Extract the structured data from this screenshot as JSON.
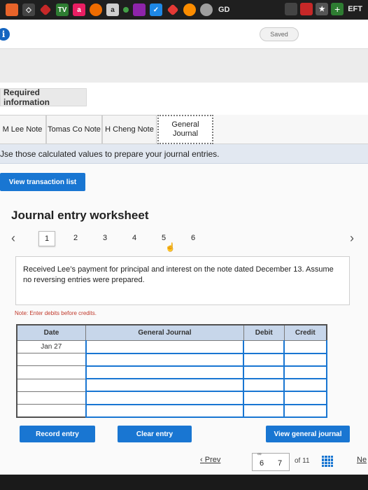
{
  "bookmarks": {
    "items": [
      {
        "icon": "stop-icon",
        "color": "#e8642a",
        "text": ""
      },
      {
        "icon": "cube-icon",
        "color": "#6a6a6a",
        "text": "◇"
      },
      {
        "icon": "diamond-icon",
        "color": "#c62828",
        "text": ""
      },
      {
        "icon": "tv-icon",
        "color": "#2e7d32",
        "text": "TV"
      },
      {
        "icon": "a-icon",
        "color": "#e91e63",
        "text": "a"
      },
      {
        "icon": "circle-icon",
        "color": "#ef6c00",
        "text": ""
      },
      {
        "icon": "amazon-icon",
        "color": "#cfcfcf",
        "text": "a"
      },
      {
        "icon": "dot-icon",
        "color": "#43a047",
        "text": ""
      },
      {
        "icon": "photo-icon",
        "color": "#8e24aa",
        "text": ""
      },
      {
        "icon": "check-icon",
        "color": "#1e88e5",
        "text": ""
      },
      {
        "icon": "gem-icon",
        "color": "#e53935",
        "text": ""
      },
      {
        "icon": "ball-icon",
        "color": "#fb8c00",
        "text": ""
      },
      {
        "icon": "gd-icon",
        "color": "#9e9e9e",
        "text": ""
      }
    ],
    "gd_label": "GD",
    "eft_label": "EFT"
  },
  "header": {
    "info_icon_glyph": "i",
    "saved_label": "Saved"
  },
  "required_info_label": "Required information",
  "tabs": [
    {
      "label": "M Lee Note"
    },
    {
      "label": "Tomas Co Note"
    },
    {
      "label": "H Cheng Note"
    },
    {
      "label": "General Journal"
    }
  ],
  "instruction_text": "Jse those calculated values to prepare your journal entries.",
  "view_transaction_label": "View transaction list",
  "worksheet": {
    "title": "Journal entry worksheet",
    "pages": [
      "1",
      "2",
      "3",
      "4",
      "5",
      "6"
    ],
    "active_page": "1",
    "description": "Received Lee’s payment for principal and interest on the note dated December 13. Assume no reversing entries were prepared.",
    "note": "Note: Enter debits before credits.",
    "columns": {
      "date": "Date",
      "general_journal": "General Journal",
      "debit": "Debit",
      "credit": "Credit"
    },
    "rows": [
      {
        "date": "Jan 27"
      },
      {
        "date": ""
      },
      {
        "date": ""
      },
      {
        "date": ""
      },
      {
        "date": ""
      },
      {
        "date": ""
      }
    ]
  },
  "buttons": {
    "record": "Record entry",
    "clear": "Clear entry",
    "view_general": "View general journal"
  },
  "footer_nav": {
    "prev": "Prev",
    "page_a": "6",
    "page_b": "7",
    "of_total": "of 11",
    "next": "Ne"
  },
  "colors": {
    "accent": "#1976d2",
    "table_header": "#c7d6ea",
    "instruction_bg": "#e2e8f1",
    "note_red": "#c0392b"
  }
}
